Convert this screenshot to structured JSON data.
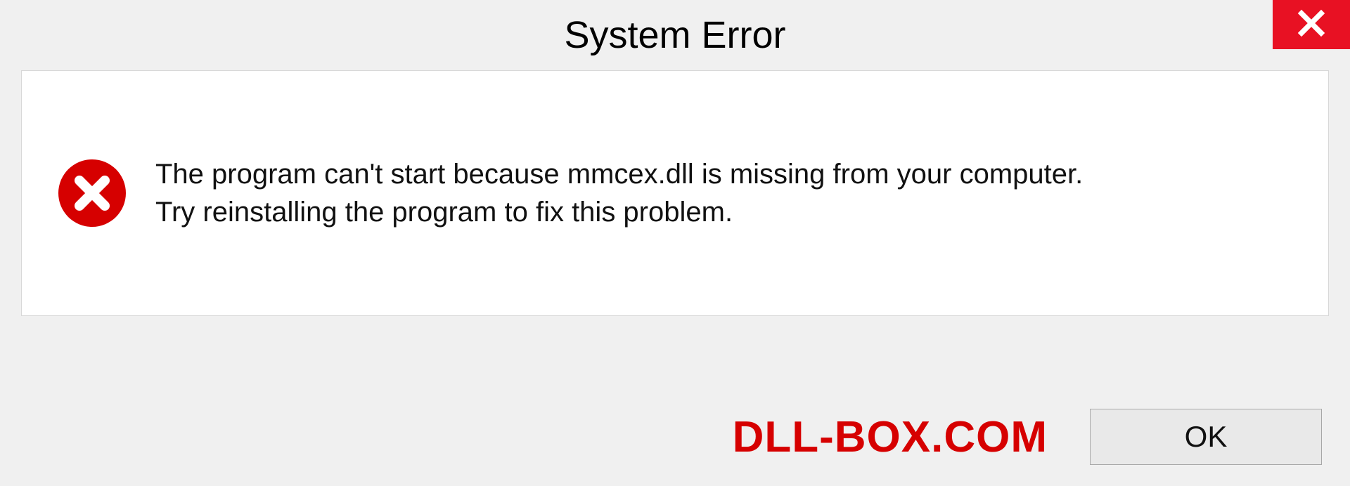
{
  "title": "System Error",
  "message_line1": "The program can't start because mmcex.dll is missing from your computer.",
  "message_line2": "Try reinstalling the program to fix this problem.",
  "ok_label": "OK",
  "watermark": "DLL-BOX.COM"
}
